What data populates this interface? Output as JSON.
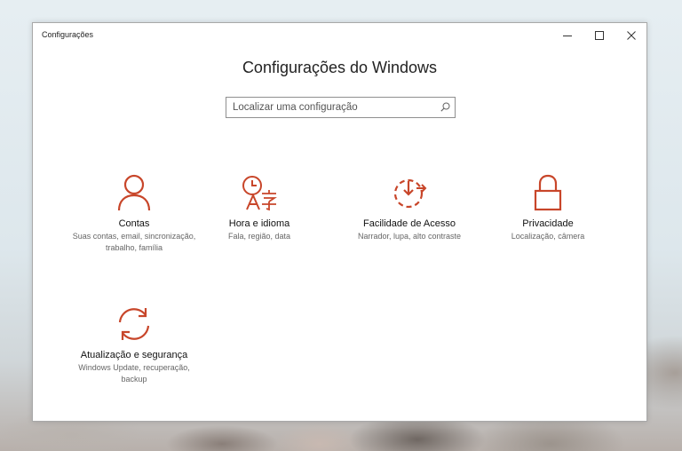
{
  "window": {
    "title": "Configurações",
    "heading": "Configurações do Windows"
  },
  "search": {
    "placeholder": "Localizar uma configuração"
  },
  "accent_color": "#c8462a",
  "tiles": [
    {
      "name": "Contas",
      "desc": "Suas contas, email, sincronização, trabalho, família",
      "icon": "person-icon"
    },
    {
      "name": "Hora e idioma",
      "desc": "Fala, região, data",
      "icon": "time-language-icon"
    },
    {
      "name": "Facilidade de Acesso",
      "desc": "Narrador, lupa, alto contraste",
      "icon": "ease-of-access-icon"
    },
    {
      "name": "Privacidade",
      "desc": "Localização, câmera",
      "icon": "lock-icon"
    },
    {
      "name": "Atualização e segurança",
      "desc": "Windows Update, recuperação, backup",
      "icon": "sync-icon"
    }
  ]
}
